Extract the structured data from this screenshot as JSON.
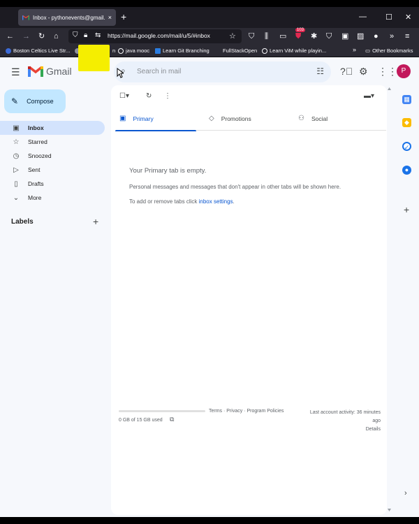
{
  "browser": {
    "tab_title": "Inbox - pythonevents@gmail.c",
    "tab_close": "×",
    "new_tab": "+",
    "window_controls": [
      "—",
      "☐",
      "✕"
    ],
    "url": "https://mail.google.com/mail/u/5/#inbox",
    "notification_badge": "103",
    "bookmarks": [
      "Boston Celtics Live Str...",
      "n",
      "java mooc",
      "Learn Git Branching",
      "FullStackOpen",
      "Learn ViM while playin...",
      "Other Bookmarks"
    ],
    "bookmarks_overflow": "»"
  },
  "gmail": {
    "brand": "Gmail",
    "search_placeholder": "Search in mail",
    "avatar_letter": "P",
    "compose_label": "Compose",
    "nav": [
      {
        "label": "Inbox",
        "icon": "inbox-icon"
      },
      {
        "label": "Starred",
        "icon": "star-icon"
      },
      {
        "label": "Snoozed",
        "icon": "clock-icon"
      },
      {
        "label": "Sent",
        "icon": "send-icon"
      },
      {
        "label": "Drafts",
        "icon": "draft-icon"
      },
      {
        "label": "More",
        "icon": "chevron-down-icon"
      }
    ],
    "labels_heading": "Labels",
    "tabs": [
      {
        "label": "Primary",
        "icon": "inbox-icon"
      },
      {
        "label": "Promotions",
        "icon": "tag-icon"
      },
      {
        "label": "Social",
        "icon": "people-icon"
      }
    ],
    "empty": {
      "title": "Your Primary tab is empty.",
      "message": "Personal messages and messages that don't appear in other tabs will be shown here.",
      "settings_prefix": "To add or remove tabs click ",
      "settings_link": "inbox settings",
      "settings_suffix": "."
    },
    "storage": "0 GB of 15 GB used",
    "footer_links": "Terms · Privacy · Program Policies",
    "activity_line1": "Last account activity: 36 minutes",
    "activity_line2": "ago",
    "activity_details": "Details"
  },
  "colors": {
    "accent": "#0b57d0",
    "compose_bg": "#c2e7ff",
    "active_nav": "#d3e3fd",
    "avatar": "#c2185b",
    "sticky_note": "#f5ee00"
  }
}
